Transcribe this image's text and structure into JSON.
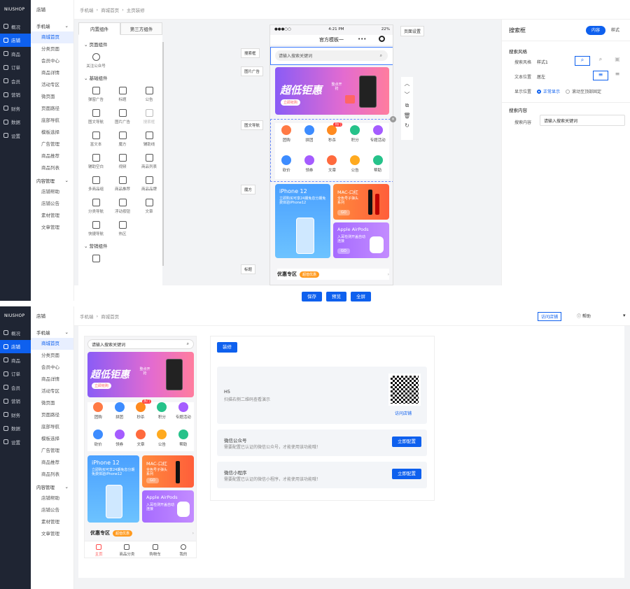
{
  "brand": "NIUSHOP",
  "nav": [
    "概况",
    "店铺",
    "商品",
    "订单",
    "会员",
    "营销",
    "财务",
    "数据",
    "设置"
  ],
  "sub": {
    "title": "店铺",
    "group1": "手机端",
    "items1": [
      "商城首页",
      "分类页面",
      "会员中心",
      "商品详情",
      "活动专区",
      "微页面",
      "页面路径",
      "底部导航",
      "模板选择",
      "广告管理",
      "商品推荐",
      "商品列表"
    ],
    "group2": "内容管理",
    "items2": [
      "店铺帮助",
      "店铺公告",
      "素材管理",
      "文章管理"
    ]
  },
  "crumb1": [
    "手机端",
    "商城首页",
    "主页装修"
  ],
  "crumb2": [
    "手机端",
    "商城首页"
  ],
  "comp": {
    "tab1": "内置组件",
    "tab2": "第三方组件",
    "g1": "页面组件",
    "g1items": [
      "关注公众号"
    ],
    "g2": "基础组件",
    "g2items": [
      "弹窗广告",
      "标题",
      "公告",
      "图文导航",
      "图片广告",
      "搜索框",
      "富文本",
      "魔方",
      "辅助线",
      "辅助空白",
      "视频",
      "商品列表",
      "多商品组",
      "商品推荐",
      "商品品牌",
      "分类导航",
      "浮动按钮",
      "文章",
      "快捷导航",
      "热区"
    ],
    "g3": "营销组件"
  },
  "phone": {
    "time": "4:21 PM",
    "battery": "22%",
    "signal": "●●●○○",
    "title": "官方模板一",
    "search": "请输入搜索关键词",
    "page_settings": "页面设置"
  },
  "banner": {
    "title": "超低钜惠",
    "side": "整点开抢",
    "tag": "立即抢购"
  },
  "navicons": [
    {
      "label": "团购",
      "color": "#ff7a45"
    },
    {
      "label": "拼团",
      "color": "#3d8cff"
    },
    {
      "label": "秒杀",
      "color": "#ff8a1f",
      "badge": "热门"
    },
    {
      "label": "积分",
      "color": "#26c28a"
    },
    {
      "label": "专题活动",
      "color": "#a55cff"
    },
    {
      "label": "砍价",
      "color": "#3d8cff"
    },
    {
      "label": "领券",
      "color": "#a55cff"
    },
    {
      "label": "文章",
      "color": "#ff6a3d"
    },
    {
      "label": "公告",
      "color": "#ffaa1f"
    },
    {
      "label": "帮助",
      "color": "#26c28a"
    }
  ],
  "cards": {
    "iphone": {
      "title": "iPhone 12",
      "sub": "立即购买可享24期免息分期免费体验iPhone12"
    },
    "lipstick": {
      "title": "MAC-口红",
      "sub": "全色号子弹头系列",
      "btn": "GO"
    },
    "airpods": {
      "title": "Apple AirPods",
      "sub": "入耳检测开盖自动连接",
      "btn": "GO"
    }
  },
  "promo": {
    "title": "优惠专区",
    "tag": "超值优惠"
  },
  "tags": {
    "search": "搜索框",
    "banner": "图片广告",
    "nav": "图文导航",
    "cube": "魔方",
    "title": "标题"
  },
  "buttons": {
    "save": "保存",
    "preview": "预览",
    "fullscreen": "全屏"
  },
  "props": {
    "title": "搜索框",
    "tab1": "内容",
    "tab2": "样式",
    "sec1": "搜索风格",
    "style_label": "搜索风格",
    "style_val": "样式1",
    "align_label": "文本位置",
    "align_val": "居左",
    "pos_label": "显示位置",
    "pos_opt1": "正常显示",
    "pos_opt2": "滚动至顶部固定",
    "sec2": "搜索内容",
    "content_label": "搜索内容",
    "content_val": "请输入搜索关键词"
  },
  "top2": {
    "visit": "访问店铺",
    "help": "帮助"
  },
  "preview": {
    "decorate": "装修",
    "h5_title": "H5",
    "h5_desc": "扫描右侧二维码查看演示",
    "visit": "访问店铺",
    "wx_title": "微信公众号",
    "wx_desc": "需要配置已认证的微信公众号，才能使用该功能哦！",
    "mp_title": "微信小程序",
    "mp_desc": "需要配置已认证的微信小程序，才能使用该功能哦！",
    "config": "立即配置"
  },
  "tabbar": [
    "主页",
    "商品分类",
    "购物车",
    "我的"
  ]
}
